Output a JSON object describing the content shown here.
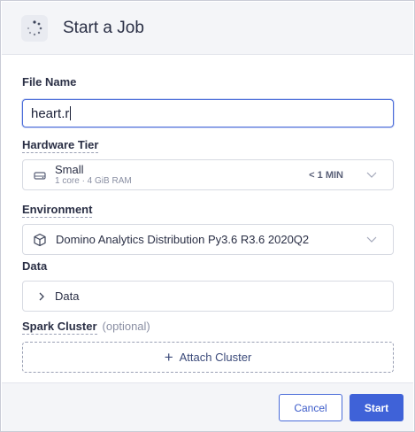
{
  "header": {
    "title": "Start a Job",
    "icon": "spinner-icon"
  },
  "file_name": {
    "label": "File Name",
    "value": "heart.r"
  },
  "hardware_tier": {
    "label": "Hardware Tier",
    "name": "Small",
    "detail": "1 core · 4 GiB RAM",
    "time": "< 1 MIN",
    "icon": "hard-drive-icon"
  },
  "environment": {
    "label": "Environment",
    "value": "Domino Analytics Distribution Py3.6 R3.6 2020Q2",
    "icon": "cube-icon"
  },
  "data_section": {
    "label": "Data",
    "value": "Data"
  },
  "spark_cluster": {
    "label": "Spark Cluster",
    "optional": "(optional)",
    "attach_label": "Attach Cluster"
  },
  "footer": {
    "cancel_label": "Cancel",
    "start_label": "Start"
  },
  "colors": {
    "accent": "#3f62d8",
    "header_bg": "#f4f5f8"
  }
}
